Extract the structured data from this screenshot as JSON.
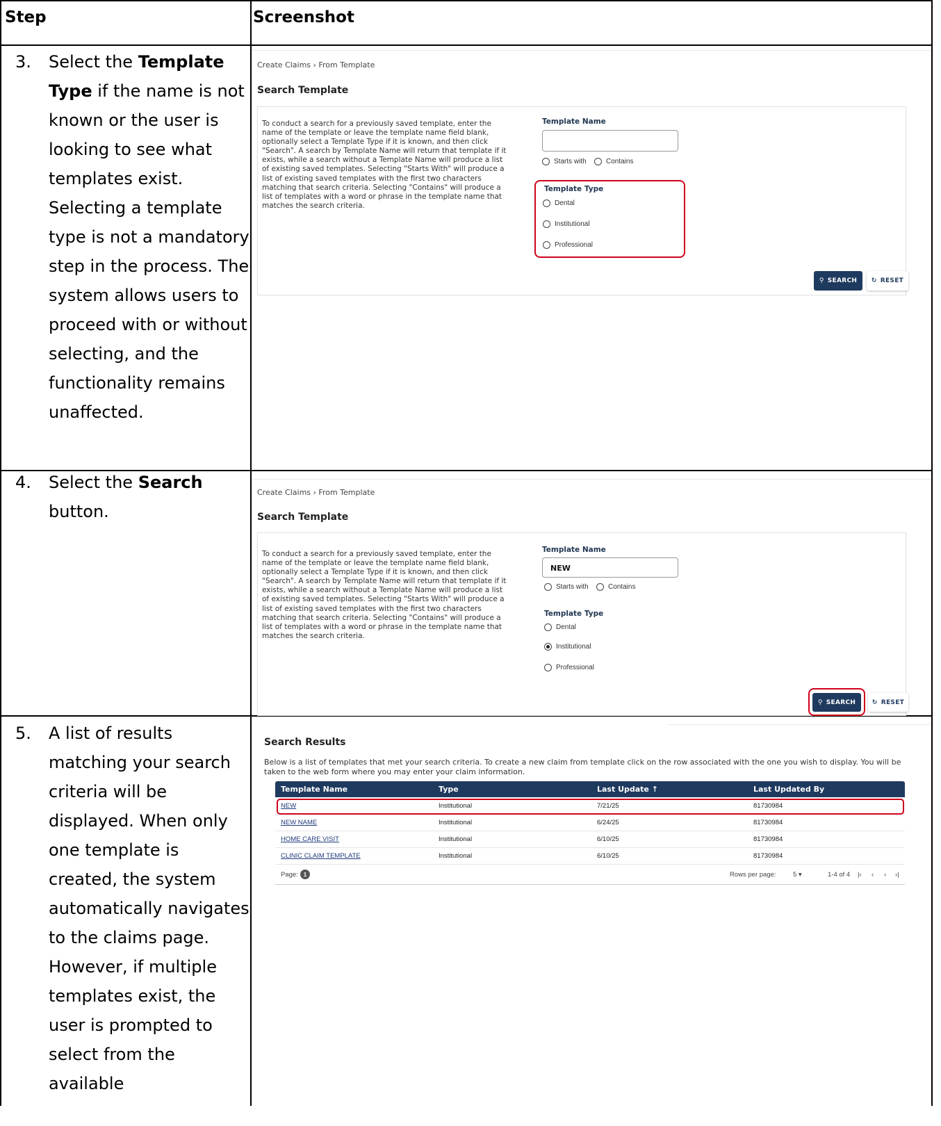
{
  "table_header": {
    "step": "Step",
    "screenshot": "Screenshot"
  },
  "steps": [
    {
      "number": "3.",
      "text_parts": [
        "Select the ",
        "Template Type",
        " if the name is not known or the user is looking to see what templates exist. Selecting a template type is not a mandatory step in the process. The system allows users to proceed with or without selecting, and the functionality remains unaffected."
      ]
    },
    {
      "number": "4.",
      "text_parts": [
        "Select the ",
        "Search",
        " button."
      ]
    },
    {
      "number": "5.",
      "text_parts": [
        "A list of results matching your search criteria will be displayed. When only one template is created, the system automatically navigates to the claims page. However, if multiple templates exist, the user is prompted to select from the available"
      ]
    }
  ],
  "search_screen": {
    "breadcrumb": "Create Claims  ›  From Template",
    "title": "Search Template",
    "description": "To conduct a search for a previously saved template, enter the name of the template or leave the template name field blank, optionally select a Template Type if it is known, and then click \"Search\". A search by Template Name will return that template if it exists, while a search without a Template Name will produce a list of existing saved templates. Selecting \"Starts With\" will produce a list of existing saved templates with the first two characters matching that search criteria. Selecting \"Contains\" will produce a list of templates with a word or phrase in the template name that matches the search criteria.",
    "template_name_label": "Template Name",
    "match_options": [
      "Starts with",
      "Contains"
    ],
    "template_type_label": "Template Type",
    "type_options": [
      "Dental",
      "Institutional",
      "Professional"
    ],
    "search_button": "SEARCH",
    "reset_button": "RESET",
    "search_icon": "search-icon",
    "reset_icon": "reset-icon"
  },
  "step3_input_value": "",
  "step4_input_value": "NEW",
  "step4_selected_type": "Institutional",
  "results": {
    "title": "Search Results",
    "description": "Below is a list of templates that met your search criteria. To create a new claim from template click on the row associated with the one you wish to display. You will be taken to the web form where you may enter your claim information.",
    "columns": [
      "Template Name",
      "Type",
      "Last Update ↑",
      "Last Updated By"
    ],
    "rows": [
      [
        "NEW",
        "Institutional",
        "7/21/25",
        "81730984"
      ],
      [
        "NEW NAME",
        "Institutional",
        "6/24/25",
        "81730984"
      ],
      [
        "HOME CARE VISIT",
        "Institutional",
        "6/10/25",
        "81730984"
      ],
      [
        "CLINIC CLAIM TEMPLATE",
        "Institutional",
        "6/10/25",
        "81730984"
      ]
    ],
    "page_label": "Page:",
    "page_number": "1",
    "rows_per_page_label": "Rows per page:",
    "rows_per_page_value": "5 ▾",
    "range": "1-4 of 4",
    "nav": [
      "|‹",
      "‹",
      "›",
      "›|"
    ]
  },
  "accent_colors": {
    "navy": "#1f3a5f",
    "highlight_red": "#d0021b"
  }
}
